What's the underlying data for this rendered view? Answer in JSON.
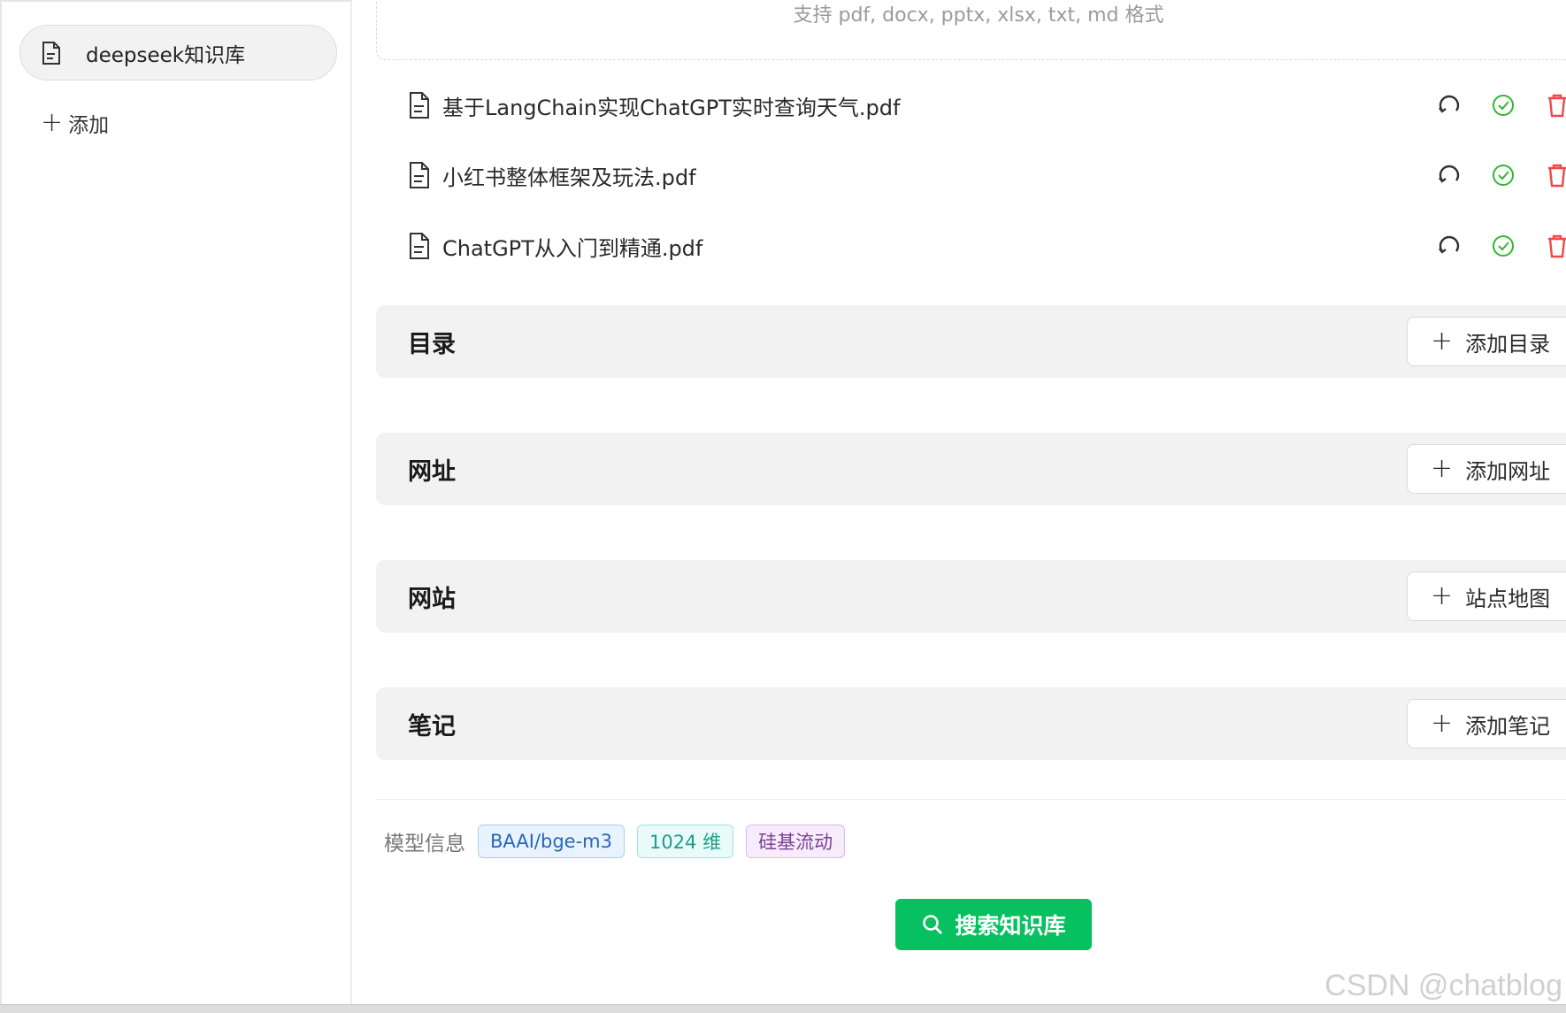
{
  "sidebar": {
    "knowledge_base": "deepseek知识库",
    "add_label": "添加"
  },
  "upload": {
    "hint": "支持 pdf, docx, pptx, xlsx, txt, md 格式"
  },
  "files": [
    {
      "name": "基于LangChain实现ChatGPT实时查询天气.pdf"
    },
    {
      "name": "小红书整体框架及玩法.pdf"
    },
    {
      "name": "ChatGPT从入门到精通.pdf"
    }
  ],
  "sections": [
    {
      "title": "目录",
      "button": "添加目录"
    },
    {
      "title": "网址",
      "button": "添加网址"
    },
    {
      "title": "网站",
      "button": "站点地图"
    },
    {
      "title": "笔记",
      "button": "添加笔记"
    }
  ],
  "model_info": {
    "label": "模型信息",
    "tags": [
      "BAAI/bge-m3",
      "1024 维",
      "硅基流动"
    ]
  },
  "search_button": "搜索知识库",
  "watermark": "CSDN @chatblog",
  "colors": {
    "primary": "#07c160",
    "check": "#2eb82e",
    "delete": "#f04848"
  }
}
